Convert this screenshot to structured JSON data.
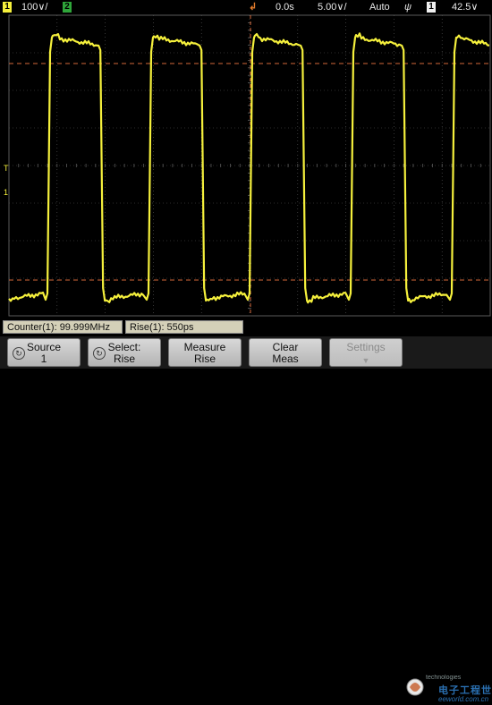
{
  "status_bar": {
    "ch1_number": "1",
    "ch1_scale": "100∨/",
    "ch2_number": "2",
    "time_delay": "0.0s",
    "time_scale": "5.00∨/",
    "trigger_mode": "Auto",
    "trigger_slope_symbol": "ψ",
    "trigger_source": "1",
    "trigger_level": "42.5∨"
  },
  "markers": {
    "trigger_level_marker": "T",
    "ch1_ground_marker": "1"
  },
  "measurements": [
    {
      "text": "Counter(1): 99.999MHz"
    },
    {
      "text": "Rise(1): 550ps"
    }
  ],
  "softkeys": [
    {
      "line1": "Source",
      "line2": "1",
      "icon": "rotary-knob-icon",
      "enabled": true
    },
    {
      "line1": "Select:",
      "line2": "Rise",
      "icon": "rotary-knob-icon",
      "enabled": true
    },
    {
      "line1": "Measure",
      "line2": "Rise",
      "enabled": true
    },
    {
      "line1": "Clear",
      "line2": "Meas",
      "enabled": true
    },
    {
      "line1": "Settings",
      "line2": "",
      "icon": "down-arrow-icon",
      "enabled": false
    }
  ],
  "watermark": {
    "line1": "电子工程世界",
    "line2": "eeworld.com.cn",
    "brand_partial": "technologies"
  },
  "colors": {
    "trace": "#f5f03c",
    "cursor_dash": "#e0703a",
    "grid": "#5a5a5a"
  },
  "waveform": {
    "type": "square",
    "high_level": "upper dashed cursor",
    "low_level": "lower dashed cursor",
    "rising_edges_div": [
      0.8,
      2.9,
      5.0,
      7.1,
      9.2
    ],
    "falling_edges_div": [
      1.9,
      4.0,
      6.1,
      8.2
    ]
  }
}
